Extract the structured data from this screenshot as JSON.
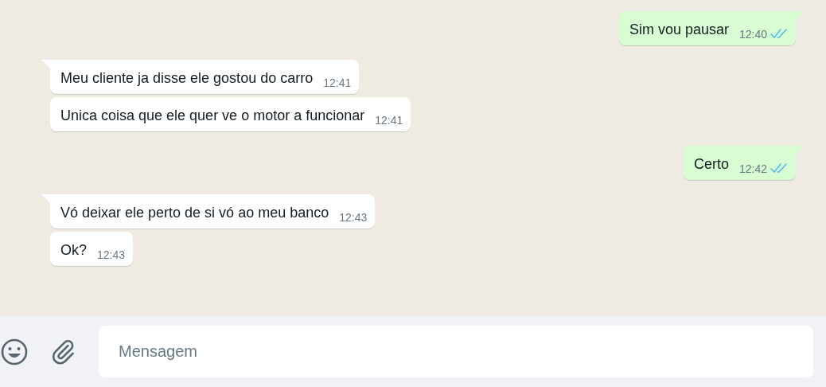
{
  "messages": [
    {
      "kind": "out",
      "tail": true,
      "text": "Sim vou pausar",
      "time": "12:40",
      "read": true
    },
    {
      "kind": "in",
      "tail": true,
      "text": "Meu cliente ja disse ele gostou do carro",
      "time": "12:41"
    },
    {
      "kind": "in",
      "tail": false,
      "text": "Unica coisa que ele quer ve o motor a funcionar",
      "time": "12:41"
    },
    {
      "kind": "out",
      "tail": true,
      "text": "Certo",
      "time": "12:42",
      "read": true
    },
    {
      "kind": "in",
      "tail": true,
      "text": "Vó deixar ele perto de si vó ao meu banco",
      "time": "12:43"
    },
    {
      "kind": "in",
      "tail": false,
      "text": "Ok?",
      "time": "12:43"
    }
  ],
  "composer": {
    "placeholder": "Mensagem"
  }
}
